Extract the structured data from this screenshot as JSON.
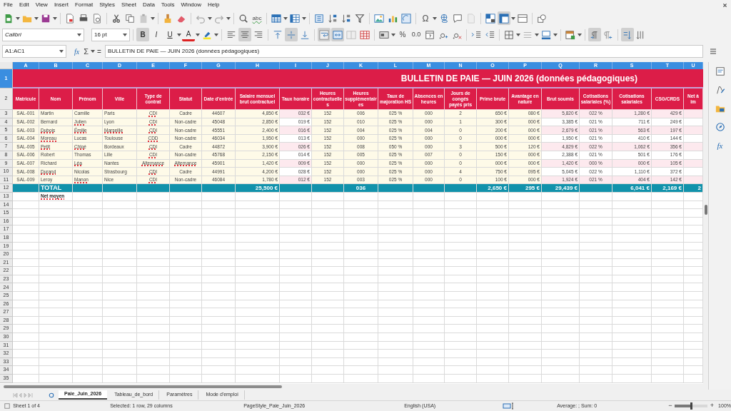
{
  "menu": [
    "File",
    "Edit",
    "View",
    "Insert",
    "Format",
    "Styles",
    "Sheet",
    "Data",
    "Tools",
    "Window",
    "Help"
  ],
  "glyphs": {
    "spellcheck": "abc",
    "special_char": "Ω",
    "bold": "B",
    "italic": "I",
    "underline": "U",
    "font_color": "A",
    "percent": "%",
    "decimal": "0.0"
  },
  "pressed": {
    "freeze": true,
    "bold": true,
    "italic": false,
    "underline": false,
    "align_left": false,
    "align_center": true,
    "align_right": false,
    "valign_top": false,
    "valign_middle": true,
    "valign_bottom": false,
    "wrap": true,
    "merge": true,
    "ltr": true,
    "rtl": false,
    "text_dir": true
  },
  "font_name": "Calibri",
  "font_size": "16 pt",
  "formula_bar": {
    "cell_ref": "A1:AC1",
    "fx": "fx",
    "sum": "Σ",
    "equals": "=",
    "content": "BULLETIN DE PAIE — JUIN 2026 (données pédagogiques)"
  },
  "sheet": {
    "columns": [
      {
        "letter": "A",
        "header": "Matricule"
      },
      {
        "letter": "B",
        "header": "Nom"
      },
      {
        "letter": "C",
        "header": "Prénom"
      },
      {
        "letter": "D",
        "header": "Ville"
      },
      {
        "letter": "E",
        "header": "Type de contrat"
      },
      {
        "letter": "F",
        "header": "Statut"
      },
      {
        "letter": "G",
        "header": "Date d'entrée"
      },
      {
        "letter": "H",
        "header": "Salaire mensuel brut contractuel"
      },
      {
        "letter": "I",
        "header": "Taux horaire"
      },
      {
        "letter": "J",
        "header": "Heures contractuelles"
      },
      {
        "letter": "K",
        "header": "Heures supplémentaires"
      },
      {
        "letter": "L",
        "header": "Taux de majoration HS"
      },
      {
        "letter": "M",
        "header": "Absences en heures"
      },
      {
        "letter": "N",
        "header": "Jours de congés payés pris"
      },
      {
        "letter": "O",
        "header": "Prime brute"
      },
      {
        "letter": "P",
        "header": "Avantage en nature"
      },
      {
        "letter": "Q",
        "header": "Brut soumis"
      },
      {
        "letter": "R",
        "header": "Cotisations salariales (%)"
      },
      {
        "letter": "S",
        "header": "Cotisations salariales"
      },
      {
        "letter": "T",
        "header": "CSG/CRDS"
      },
      {
        "letter": "U",
        "header": "Net à im"
      }
    ],
    "title_row": {
      "number": "1",
      "title": "BULLETIN DE PAIE — JUIN 2026 (données pédagogiques)"
    },
    "header_row_number": "2",
    "rows": [
      {
        "number": "3",
        "kind": "data",
        "cells": {
          "A": {
            "text": "SAL-001",
            "misspelled": false
          },
          "B": {
            "text": "Martin",
            "misspelled": false
          },
          "C": {
            "text": "Camille",
            "misspelled": false
          },
          "D": {
            "text": "Paris",
            "misspelled": false
          },
          "E": {
            "text": "CDI",
            "misspelled": true
          },
          "F": {
            "text": "Cadre",
            "misspelled": false
          },
          "G": {
            "text": "44607",
            "misspelled": false
          },
          "H": {
            "text": "4,850 €",
            "misspelled": false
          },
          "I": {
            "text": "032 €",
            "misspelled": false
          },
          "J": {
            "text": "152",
            "misspelled": false
          },
          "K": {
            "text": "006",
            "misspelled": false
          },
          "L": {
            "text": "025 %",
            "misspelled": false
          },
          "M": {
            "text": "000",
            "misspelled": false
          },
          "N": {
            "text": "2",
            "misspelled": false
          },
          "O": {
            "text": "650 €",
            "misspelled": false
          },
          "P": {
            "text": "080 €",
            "misspelled": false
          },
          "Q": {
            "text": "5,820 €",
            "misspelled": false
          },
          "R": {
            "text": "022 %",
            "misspelled": false
          },
          "S": {
            "text": "1,280 €",
            "misspelled": false
          },
          "T": {
            "text": "429 €",
            "misspelled": false
          }
        }
      },
      {
        "number": "4",
        "kind": "data",
        "cells": {
          "A": {
            "text": "SAL-002",
            "misspelled": false
          },
          "B": {
            "text": "Bernard",
            "misspelled": false
          },
          "C": {
            "text": "Julien",
            "misspelled": true
          },
          "D": {
            "text": "Lyon",
            "misspelled": false
          },
          "E": {
            "text": "CDI",
            "misspelled": true
          },
          "F": {
            "text": "Non-cadre",
            "misspelled": false
          },
          "G": {
            "text": "45048",
            "misspelled": false
          },
          "H": {
            "text": "2,850 €",
            "misspelled": false
          },
          "I": {
            "text": "019 €",
            "misspelled": false
          },
          "J": {
            "text": "152",
            "misspelled": false
          },
          "K": {
            "text": "010",
            "misspelled": false
          },
          "L": {
            "text": "025 %",
            "misspelled": false
          },
          "M": {
            "text": "000",
            "misspelled": false
          },
          "N": {
            "text": "1",
            "misspelled": false
          },
          "O": {
            "text": "300 €",
            "misspelled": false
          },
          "P": {
            "text": "000 €",
            "misspelled": false
          },
          "Q": {
            "text": "3,385 €",
            "misspelled": false
          },
          "R": {
            "text": "021 %",
            "misspelled": false
          },
          "S": {
            "text": "711 €",
            "misspelled": false
          },
          "T": {
            "text": "249 €",
            "misspelled": false
          }
        }
      },
      {
        "number": "5",
        "kind": "data",
        "cells": {
          "A": {
            "text": "SAL-003",
            "misspelled": false
          },
          "B": {
            "text": "Dubois",
            "misspelled": true
          },
          "C": {
            "text": "Émilie",
            "misspelled": true
          },
          "D": {
            "text": "Marseille",
            "misspelled": true
          },
          "E": {
            "text": "CDI",
            "misspelled": true
          },
          "F": {
            "text": "Non-cadre",
            "misspelled": false
          },
          "G": {
            "text": "45551",
            "misspelled": false
          },
          "H": {
            "text": "2,400 €",
            "misspelled": false
          },
          "I": {
            "text": "016 €",
            "misspelled": false
          },
          "J": {
            "text": "152",
            "misspelled": false
          },
          "K": {
            "text": "004",
            "misspelled": false
          },
          "L": {
            "text": "025 %",
            "misspelled": false
          },
          "M": {
            "text": "004",
            "misspelled": false
          },
          "N": {
            "text": "0",
            "misspelled": false
          },
          "O": {
            "text": "200 €",
            "misspelled": false
          },
          "P": {
            "text": "000 €",
            "misspelled": false
          },
          "Q": {
            "text": "2,679 €",
            "misspelled": false
          },
          "R": {
            "text": "021 %",
            "misspelled": false
          },
          "S": {
            "text": "563 €",
            "misspelled": false
          },
          "T": {
            "text": "197 €",
            "misspelled": false
          }
        }
      },
      {
        "number": "6",
        "kind": "data",
        "cells": {
          "A": {
            "text": "SAL-004",
            "misspelled": false
          },
          "B": {
            "text": "Moreau",
            "misspelled": true
          },
          "C": {
            "text": "Lucas",
            "misspelled": false
          },
          "D": {
            "text": "Toulouse",
            "misspelled": false
          },
          "E": {
            "text": "CDD",
            "misspelled": true
          },
          "F": {
            "text": "Non-cadre",
            "misspelled": false
          },
          "G": {
            "text": "46034",
            "misspelled": false
          },
          "H": {
            "text": "1,950 €",
            "misspelled": false
          },
          "I": {
            "text": "013 €",
            "misspelled": false
          },
          "J": {
            "text": "152",
            "misspelled": false
          },
          "K": {
            "text": "000",
            "misspelled": false
          },
          "L": {
            "text": "025 %",
            "misspelled": false
          },
          "M": {
            "text": "000",
            "misspelled": false
          },
          "N": {
            "text": "0",
            "misspelled": false
          },
          "O": {
            "text": "000 €",
            "misspelled": false
          },
          "P": {
            "text": "000 €",
            "misspelled": false
          },
          "Q": {
            "text": "1,950 €",
            "misspelled": false
          },
          "R": {
            "text": "021 %",
            "misspelled": false
          },
          "S": {
            "text": "410 €",
            "misspelled": false
          },
          "T": {
            "text": "144 €",
            "misspelled": false
          }
        }
      },
      {
        "number": "7",
        "kind": "data",
        "cells": {
          "A": {
            "text": "SAL-005",
            "misspelled": false
          },
          "B": {
            "text": "Petit",
            "misspelled": true
          },
          "C": {
            "text": "Chloé",
            "misspelled": true
          },
          "D": {
            "text": "Bordeaux",
            "misspelled": false
          },
          "E": {
            "text": "CDI",
            "misspelled": true
          },
          "F": {
            "text": "Cadre",
            "misspelled": false
          },
          "G": {
            "text": "44872",
            "misspelled": false
          },
          "H": {
            "text": "3,900 €",
            "misspelled": false
          },
          "I": {
            "text": "026 €",
            "misspelled": false
          },
          "J": {
            "text": "152",
            "misspelled": false
          },
          "K": {
            "text": "008",
            "misspelled": false
          },
          "L": {
            "text": "050 %",
            "misspelled": false
          },
          "M": {
            "text": "000",
            "misspelled": false
          },
          "N": {
            "text": "3",
            "misspelled": false
          },
          "O": {
            "text": "500 €",
            "misspelled": false
          },
          "P": {
            "text": "120 €",
            "misspelled": false
          },
          "Q": {
            "text": "4,829 €",
            "misspelled": false
          },
          "R": {
            "text": "022 %",
            "misspelled": false
          },
          "S": {
            "text": "1,062 €",
            "misspelled": false
          },
          "T": {
            "text": "356 €",
            "misspelled": false
          }
        }
      },
      {
        "number": "8",
        "kind": "data",
        "cells": {
          "A": {
            "text": "SAL-006",
            "misspelled": false
          },
          "B": {
            "text": "Robert",
            "misspelled": false
          },
          "C": {
            "text": "Thomas",
            "misspelled": false
          },
          "D": {
            "text": "Lille",
            "misspelled": false
          },
          "E": {
            "text": "CDI",
            "misspelled": true
          },
          "F": {
            "text": "Non-cadre",
            "misspelled": false
          },
          "G": {
            "text": "45768",
            "misspelled": false
          },
          "H": {
            "text": "2,150 €",
            "misspelled": false
          },
          "I": {
            "text": "014 €",
            "misspelled": false
          },
          "J": {
            "text": "152",
            "misspelled": false
          },
          "K": {
            "text": "005",
            "misspelled": false
          },
          "L": {
            "text": "025 %",
            "misspelled": false
          },
          "M": {
            "text": "007",
            "misspelled": false
          },
          "N": {
            "text": "0",
            "misspelled": false
          },
          "O": {
            "text": "150 €",
            "misspelled": false
          },
          "P": {
            "text": "000 €",
            "misspelled": false
          },
          "Q": {
            "text": "2,388 €",
            "misspelled": false
          },
          "R": {
            "text": "021 %",
            "misspelled": false
          },
          "S": {
            "text": "501 €",
            "misspelled": false
          },
          "T": {
            "text": "176 €",
            "misspelled": false
          }
        }
      },
      {
        "number": "9",
        "kind": "data",
        "cells": {
          "A": {
            "text": "SAL-007",
            "misspelled": false
          },
          "B": {
            "text": "Richard",
            "misspelled": false
          },
          "C": {
            "text": "Léa",
            "misspelled": true
          },
          "D": {
            "text": "Nantes",
            "misspelled": false
          },
          "E": {
            "text": "Alternance",
            "misspelled": true
          },
          "F": {
            "text": "Alternance",
            "misspelled": true
          },
          "G": {
            "text": "45901",
            "misspelled": false
          },
          "H": {
            "text": "1,420 €",
            "misspelled": false
          },
          "I": {
            "text": "009 €",
            "misspelled": false
          },
          "J": {
            "text": "152",
            "misspelled": false
          },
          "K": {
            "text": "000",
            "misspelled": false
          },
          "L": {
            "text": "025 %",
            "misspelled": false
          },
          "M": {
            "text": "000",
            "misspelled": false
          },
          "N": {
            "text": "0",
            "misspelled": false
          },
          "O": {
            "text": "000 €",
            "misspelled": false
          },
          "P": {
            "text": "000 €",
            "misspelled": false
          },
          "Q": {
            "text": "1,420 €",
            "misspelled": false
          },
          "R": {
            "text": "000 %",
            "misspelled": false
          },
          "S": {
            "text": "000 €",
            "misspelled": false
          },
          "T": {
            "text": "105 €",
            "misspelled": false
          }
        }
      },
      {
        "number": "10",
        "kind": "data",
        "cells": {
          "A": {
            "text": "SAL-008",
            "misspelled": false
          },
          "B": {
            "text": "Durand",
            "misspelled": true
          },
          "C": {
            "text": "Nicolas",
            "misspelled": false
          },
          "D": {
            "text": "Strasbourg",
            "misspelled": false
          },
          "E": {
            "text": "CDI",
            "misspelled": true
          },
          "F": {
            "text": "Cadre",
            "misspelled": false
          },
          "G": {
            "text": "44991",
            "misspelled": false
          },
          "H": {
            "text": "4,200 €",
            "misspelled": false
          },
          "I": {
            "text": "028 €",
            "misspelled": false
          },
          "J": {
            "text": "152",
            "misspelled": false
          },
          "K": {
            "text": "000",
            "misspelled": false
          },
          "L": {
            "text": "025 %",
            "misspelled": false
          },
          "M": {
            "text": "000",
            "misspelled": false
          },
          "N": {
            "text": "4",
            "misspelled": false
          },
          "O": {
            "text": "750 €",
            "misspelled": false
          },
          "P": {
            "text": "095 €",
            "misspelled": false
          },
          "Q": {
            "text": "5,045 €",
            "misspelled": false
          },
          "R": {
            "text": "022 %",
            "misspelled": false
          },
          "S": {
            "text": "1,110 €",
            "misspelled": false
          },
          "T": {
            "text": "372 €",
            "misspelled": false
          }
        }
      },
      {
        "number": "11",
        "kind": "data",
        "cells": {
          "A": {
            "text": "SAL-009",
            "misspelled": false
          },
          "B": {
            "text": "Leroy",
            "misspelled": false
          },
          "C": {
            "text": "Manon",
            "misspelled": true
          },
          "D": {
            "text": "Nice",
            "misspelled": false
          },
          "E": {
            "text": "CDI",
            "misspelled": true
          },
          "F": {
            "text": "Non-cadre",
            "misspelled": false
          },
          "G": {
            "text": "46084",
            "misspelled": false
          },
          "H": {
            "text": "1,780 €",
            "misspelled": false
          },
          "I": {
            "text": "012 €",
            "misspelled": false
          },
          "J": {
            "text": "152",
            "misspelled": false
          },
          "K": {
            "text": "003",
            "misspelled": false
          },
          "L": {
            "text": "025 %",
            "misspelled": false
          },
          "M": {
            "text": "000",
            "misspelled": false
          },
          "N": {
            "text": "0",
            "misspelled": false
          },
          "O": {
            "text": "100 €",
            "misspelled": false
          },
          "P": {
            "text": "000 €",
            "misspelled": false
          },
          "Q": {
            "text": "1,924 €",
            "misspelled": false
          },
          "R": {
            "text": "021 %",
            "misspelled": false
          },
          "S": {
            "text": "404 €",
            "misspelled": false
          },
          "T": {
            "text": "142 €",
            "misspelled": false
          }
        }
      },
      {
        "number": "12",
        "kind": "total",
        "cells": {
          "B": {
            "text": "TOTAL",
            "misspelled": false
          },
          "H": {
            "text": "25,500 €",
            "misspelled": false
          },
          "K": {
            "text": "036",
            "misspelled": false
          },
          "O": {
            "text": "2,650 €",
            "misspelled": false
          },
          "P": {
            "text": "295 €",
            "misspelled": false
          },
          "Q": {
            "text": "29,439 €",
            "misspelled": false
          },
          "S": {
            "text": "6,041 €",
            "misspelled": false
          },
          "T": {
            "text": "2,169 €",
            "misspelled": false
          },
          "U": {
            "text": "2",
            "misspelled": false
          }
        }
      },
      {
        "number": "13",
        "kind": "note",
        "cells": {
          "B": {
            "text": "Net moyen",
            "misspelled": true
          }
        }
      }
    ],
    "empty_rows": [
      "14",
      "15",
      "16",
      "17",
      "18",
      "19",
      "20",
      "21",
      "22",
      "23",
      "24",
      "25",
      "26",
      "27",
      "28",
      "29",
      "30",
      "31",
      "32",
      "33",
      "34",
      "35"
    ]
  },
  "sidebar": {
    "functions_label": "fx"
  },
  "sheet_tabs": [
    {
      "label": "Paie_Juin_2026",
      "selected": true
    },
    {
      "label": "Tableau_de_bord",
      "selected": false
    },
    {
      "label": "Paramètres",
      "selected": false
    },
    {
      "label": "Mode d'emploi",
      "selected": false
    }
  ],
  "status_bar": {
    "sheet": "Sheet 1 of 4",
    "selection": "Selected: 1 row, 29 columns",
    "page_style": "PageStyle_Paie_Juin_2026",
    "language": "English (USA)",
    "summary": "Average: ; Sum: 0",
    "zoom_minus": "−",
    "zoom_plus": "+",
    "zoom": "100%"
  },
  "zoom_slider": {
    "level": 0.5
  }
}
